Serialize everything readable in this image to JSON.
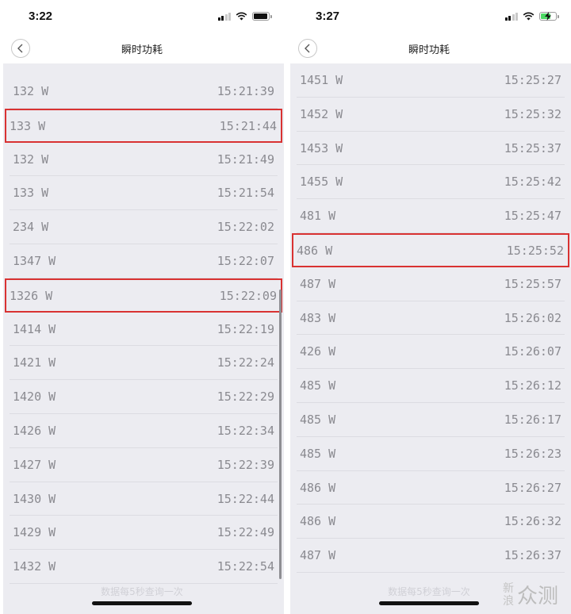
{
  "screens": [
    {
      "status_time": "3:22",
      "title": "瞬时功耗",
      "footer_note": "数据每5秒查询一次",
      "rows": [
        {
          "watts": "132 W",
          "time": "15:21:39"
        },
        {
          "watts": "133 W",
          "time": "15:21:44"
        },
        {
          "watts": "132 W",
          "time": "15:21:49"
        },
        {
          "watts": "133 W",
          "time": "15:21:54"
        },
        {
          "watts": "234 W",
          "time": "15:22:02"
        },
        {
          "watts": "1347 W",
          "time": "15:22:07"
        },
        {
          "watts": "1326 W",
          "time": "15:22:09"
        },
        {
          "watts": "1414 W",
          "time": "15:22:19"
        },
        {
          "watts": "1421 W",
          "time": "15:22:24"
        },
        {
          "watts": "1420 W",
          "time": "15:22:29"
        },
        {
          "watts": "1426 W",
          "time": "15:22:34"
        },
        {
          "watts": "1427 W",
          "time": "15:22:39"
        },
        {
          "watts": "1430 W",
          "time": "15:22:44"
        },
        {
          "watts": "1429 W",
          "time": "15:22:49"
        },
        {
          "watts": "1432 W",
          "time": "15:22:54"
        }
      ],
      "highlighted_rows": [
        1,
        6
      ],
      "battery_level": 0.85,
      "battery_charging": false
    },
    {
      "status_time": "3:27",
      "title": "瞬时功耗",
      "footer_note": "数据每5秒查询一次",
      "rows": [
        {
          "watts": "1451 W",
          "time": "15:25:27"
        },
        {
          "watts": "1452 W",
          "time": "15:25:32"
        },
        {
          "watts": "1453 W",
          "time": "15:25:37"
        },
        {
          "watts": "1455 W",
          "time": "15:25:42"
        },
        {
          "watts": "481 W",
          "time": "15:25:47"
        },
        {
          "watts": "486 W",
          "time": "15:25:52"
        },
        {
          "watts": "487 W",
          "time": "15:25:57"
        },
        {
          "watts": "483 W",
          "time": "15:26:02"
        },
        {
          "watts": "426 W",
          "time": "15:26:07"
        },
        {
          "watts": "485 W",
          "time": "15:26:12"
        },
        {
          "watts": "485 W",
          "time": "15:26:17"
        },
        {
          "watts": "485 W",
          "time": "15:26:23"
        },
        {
          "watts": "486 W",
          "time": "15:26:27"
        },
        {
          "watts": "486 W",
          "time": "15:26:32"
        },
        {
          "watts": "487 W",
          "time": "15:26:37"
        }
      ],
      "highlighted_rows": [
        5
      ],
      "battery_level": 0.6,
      "battery_charging": true
    }
  ],
  "highlight_color": "#d93232",
  "watermark": {
    "line1": "新浪",
    "line2": "众测"
  }
}
